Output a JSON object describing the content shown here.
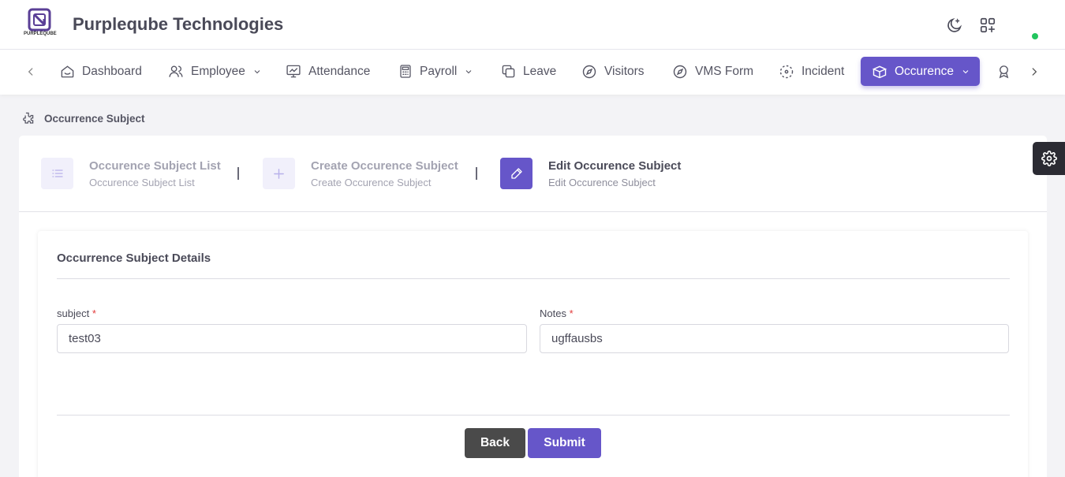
{
  "header": {
    "logo_text": "PURPLEQUBE",
    "brand": "Purpleqube Technologies",
    "theme_icon": "moon-icon",
    "apps_icon": "apps-add-icon",
    "status_color": "#22c55e"
  },
  "nav": {
    "items": [
      {
        "label": "Dashboard",
        "icon": "home-icon"
      },
      {
        "label": "Employee",
        "icon": "users-icon",
        "dropdown": true
      },
      {
        "label": "Attendance",
        "icon": "monitor-chart-icon"
      },
      {
        "label": "Payroll",
        "icon": "calculator-icon",
        "dropdown": true
      },
      {
        "label": "Leave",
        "icon": "copy-icon"
      },
      {
        "label": "Visitors",
        "icon": "compass-icon"
      },
      {
        "label": "VMS Form",
        "icon": "compass-icon"
      },
      {
        "label": "Incident",
        "icon": "focus-icon"
      },
      {
        "label": "Occurence",
        "icon": "box-icon",
        "dropdown": true,
        "active": true
      }
    ],
    "accent": "#6656c9"
  },
  "breadcrumb": {
    "label": "Occurrence Subject"
  },
  "steps": [
    {
      "title": "Occurence Subject List",
      "subtitle": "Occurence Subject List",
      "icon": "list-icon"
    },
    {
      "title": "Create Occurence Subject",
      "subtitle": "Create Occurence Subject",
      "icon": "plus-icon"
    },
    {
      "title": "Edit Occurence Subject",
      "subtitle": "Edit Occurence Subject",
      "icon": "pencil-icon",
      "active": true
    }
  ],
  "form": {
    "title": "Occurrence Subject Details",
    "subject_label": "subject",
    "subject_value": "test03",
    "notes_label": "Notes",
    "notes_value": "ugffausbs",
    "required_mark": "*",
    "back_label": "Back",
    "submit_label": "Submit"
  }
}
